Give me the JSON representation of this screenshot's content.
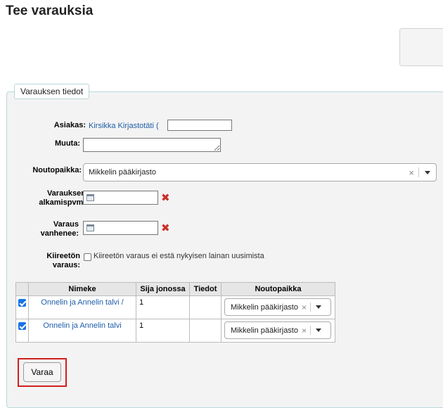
{
  "page": {
    "title": "Tee varauksia"
  },
  "form": {
    "legend": "Varauksen tiedot",
    "patron_label": "Asiakas:",
    "patron_link": "Kirsikka Kirjastotäti (",
    "notes_label": "Muuta:",
    "notes_value": "",
    "pickup_label": "Noutopaikka:",
    "pickup_value": "Mikkelin pääkirjasto",
    "start_label_line1": "Varauksen",
    "start_label_line2": "alkamispvm:",
    "start_value": "",
    "expire_label_line1": "Varaus",
    "expire_label_line2": "vanhenee:",
    "expire_value": "",
    "nonpriority_label_line1": "Kiireetön",
    "nonpriority_label_line2": "varaus:",
    "nonpriority_text": "Kiireetön varaus ei estä nykyisen lainan uusimista",
    "nonpriority_checked": false
  },
  "table": {
    "headers": [
      "Nimeke",
      "Sija jonossa",
      "Tiedot",
      "Noutopaikka"
    ],
    "rows": [
      {
        "checked": true,
        "title": "Onnelin ja Annelin talvi /",
        "queue": "1",
        "details": "",
        "pickup": "Mikkelin pääkirjasto"
      },
      {
        "checked": true,
        "title": "Onnelin ja Annelin talvi",
        "queue": "1",
        "details": "",
        "pickup": "Mikkelin pääkirjasto"
      }
    ]
  },
  "actions": {
    "submit_label": "Varaa"
  },
  "icons": {
    "clear": "×",
    "remove_date": "✖"
  },
  "colors": {
    "link": "#1f5ea8",
    "remove_date": "#c9302c",
    "highlight": "#d11f1f",
    "checkbox_checked": "#1a73e8"
  }
}
